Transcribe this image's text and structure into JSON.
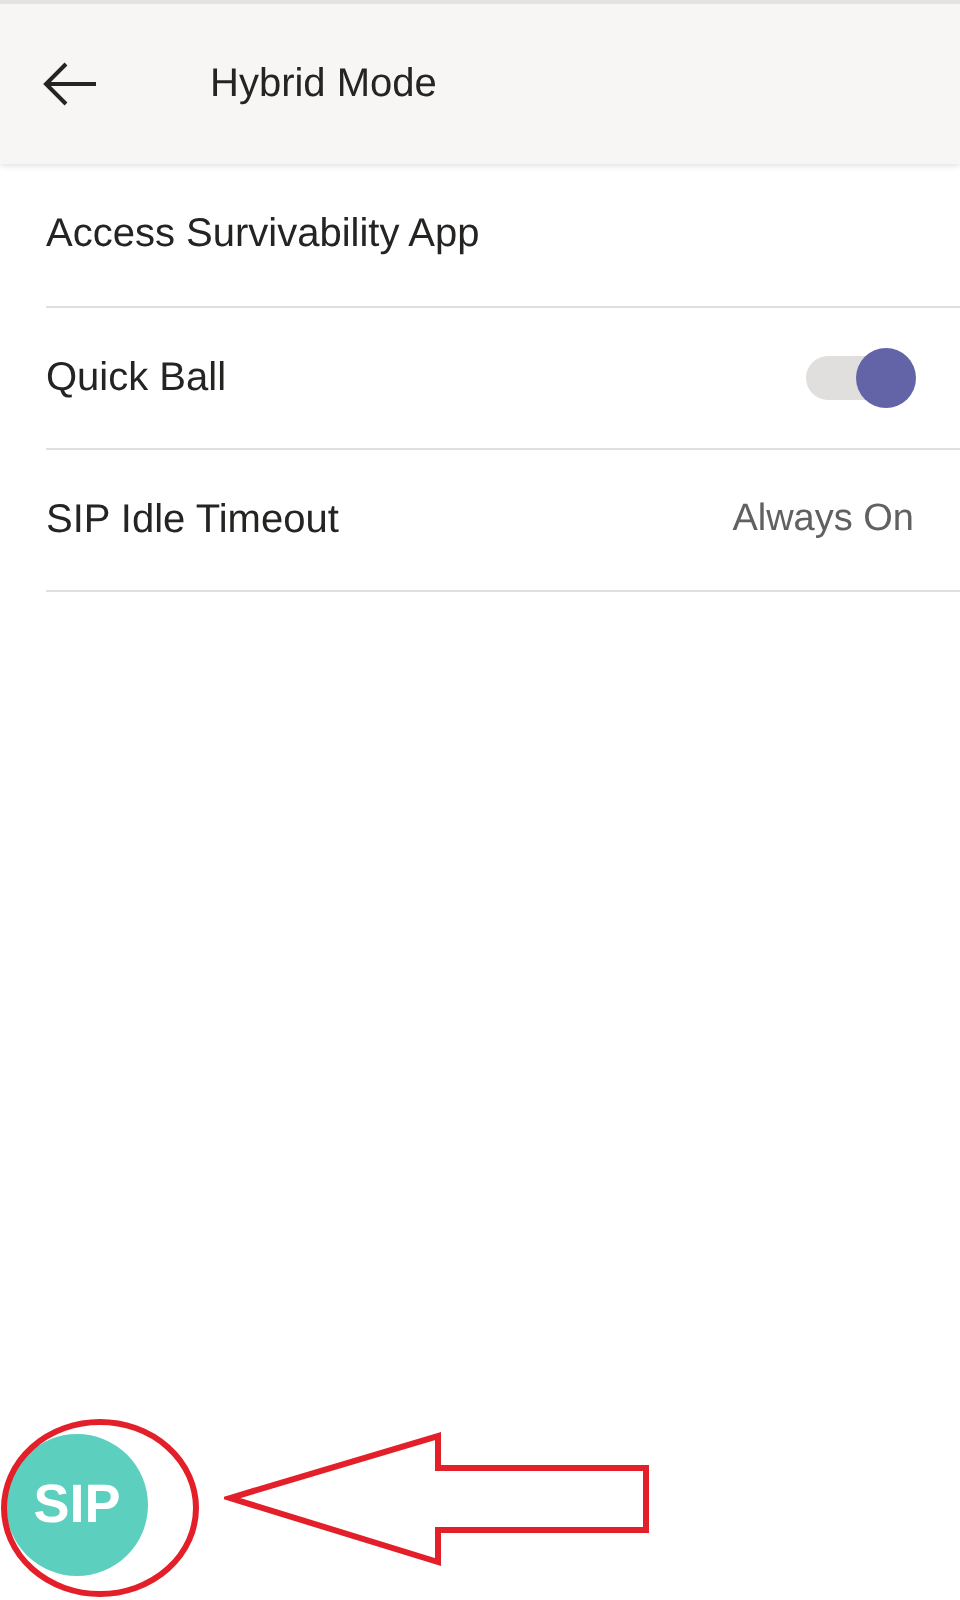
{
  "header": {
    "title": "Hybrid Mode"
  },
  "settings": [
    {
      "kind": "link",
      "label": "Access Survivability App"
    },
    {
      "kind": "toggle",
      "label": "Quick Ball",
      "on": true
    },
    {
      "kind": "value",
      "label": "SIP Idle Timeout",
      "value": "Always On"
    }
  ],
  "quick_ball": {
    "label": "SIP"
  }
}
